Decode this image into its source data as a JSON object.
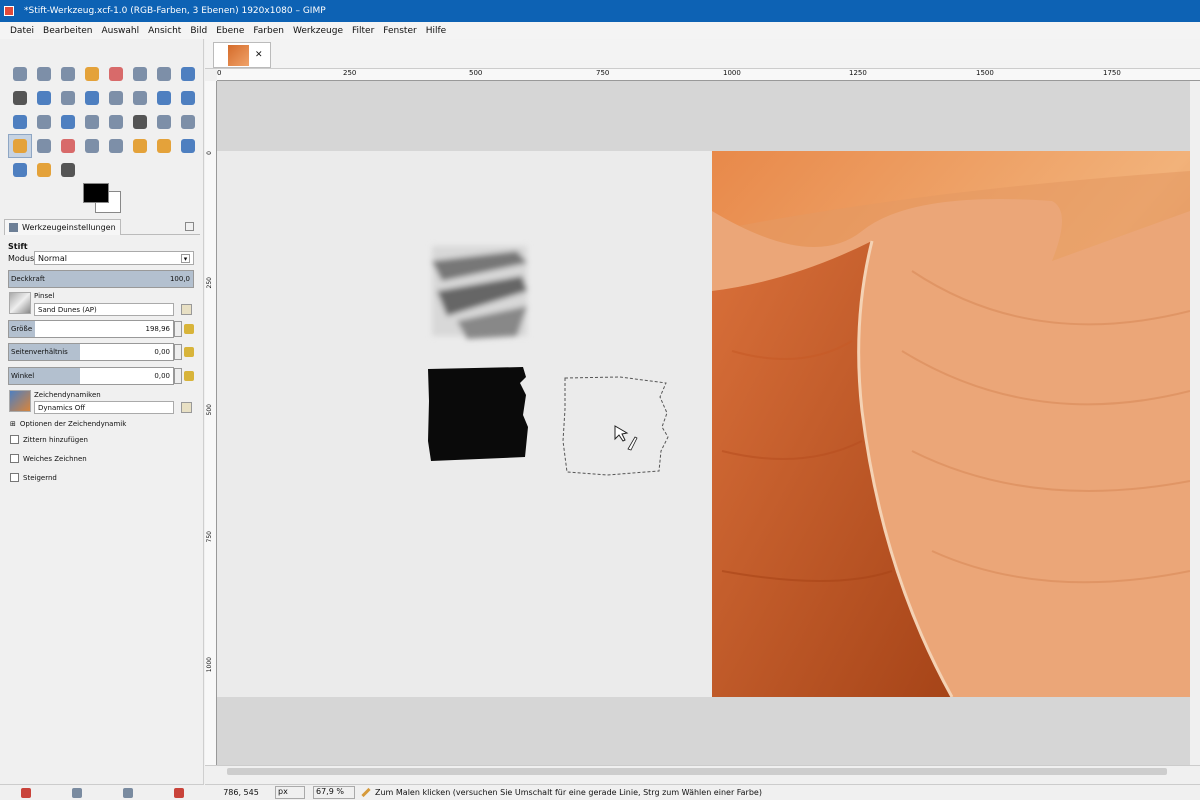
{
  "window": {
    "title": "*Stift-Werkzeug.xcf-1.0 (RGB-Farben, 3 Ebenen) 1920x1080 – GIMP"
  },
  "menu": [
    "Datei",
    "Bearbeiten",
    "Auswahl",
    "Ansicht",
    "Bild",
    "Ebene",
    "Farben",
    "Werkzeuge",
    "Filter",
    "Fenster",
    "Hilfe"
  ],
  "colors": {
    "foreground": "#000000",
    "background": "#ffffff",
    "accent": "#0d62b4",
    "slider_fill": "#b3c0cf"
  },
  "tool_options": {
    "tab_label": "Werkzeugeinstellungen",
    "tool_name": "Stift",
    "mode_label": "Modus:",
    "mode_value": "Normal",
    "opacity_label": "Deckkraft",
    "opacity_value": "100,0",
    "opacity_fraction": 1.0,
    "brush_label": "Pinsel",
    "brush_value": "Sand Dunes (AP)",
    "size_label": "Größe",
    "size_value": "198,96",
    "size_fraction": 0.16,
    "aspect_label": "Seitenverhältnis",
    "aspect_value": "0,00",
    "aspect_fraction": 0.43,
    "angle_label": "Winkel",
    "angle_value": "0,00",
    "angle_fraction": 0.43,
    "dynamics_label": "Zeichendynamiken",
    "dynamics_value": "Dynamics Off",
    "dynamics_options": "Optionen der Zeichendynamik",
    "jitter": "Zittern hinzufügen",
    "smooth": "Weiches Zeichnen",
    "incremental": "Steigernd"
  },
  "ruler": {
    "h_ticks": [
      "0",
      "250",
      "500",
      "750",
      "1000",
      "1250",
      "1500",
      "1750"
    ],
    "v_ticks": [
      "0",
      "250",
      "500",
      "750",
      "1000"
    ]
  },
  "status": {
    "coords": "786, 545",
    "unit": "px",
    "zoom": "67,9 %",
    "hint": "Zum Malen klicken (versuchen Sie Umschalt für eine gerade Linie, Strg zum Wählen einer Farbe)"
  }
}
